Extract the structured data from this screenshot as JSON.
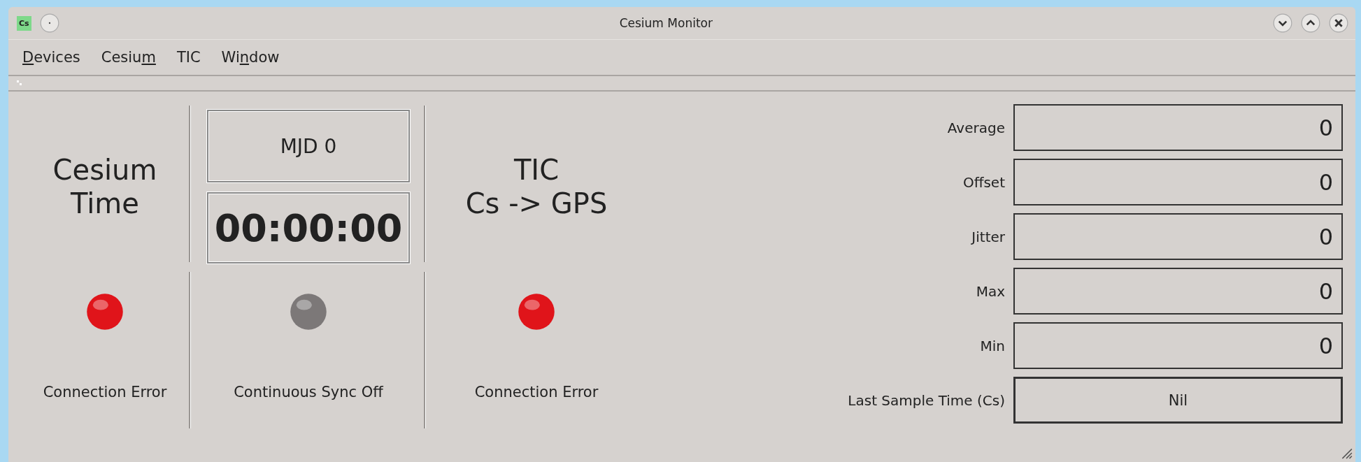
{
  "window": {
    "title": "Cesium Monitor",
    "app_badge": "Cs"
  },
  "menu": [
    {
      "key": "D",
      "after": "evices"
    },
    {
      "before": "Cesiu",
      "key": "m"
    },
    {
      "before": "TIC"
    },
    {
      "before": "Wi",
      "key": "n",
      "after": "dow"
    }
  ],
  "panels": [
    {
      "kind": "title",
      "lines": [
        "Cesium",
        "Time"
      ],
      "color": "#e0141a",
      "status": "Connection Error"
    },
    {
      "kind": "clock",
      "mjd": "MJD 0",
      "time": "00:00:00",
      "color": "#7c7878",
      "status": "Continuous Sync Off"
    },
    {
      "kind": "title",
      "lines": [
        "TIC",
        "Cs -> GPS"
      ],
      "color": "#e0141a",
      "status": "Connection Error"
    }
  ],
  "stats": [
    {
      "label": "Average",
      "value": "0",
      "kind": "number"
    },
    {
      "label": "Offset",
      "value": "0",
      "kind": "number"
    },
    {
      "label": "Jitter",
      "value": "0",
      "kind": "number"
    },
    {
      "label": "Max",
      "value": "0",
      "kind": "number"
    },
    {
      "label": "Min",
      "value": "0",
      "kind": "number"
    },
    {
      "label": "Last Sample Time (Cs)",
      "value": "Nil",
      "kind": "text"
    }
  ]
}
